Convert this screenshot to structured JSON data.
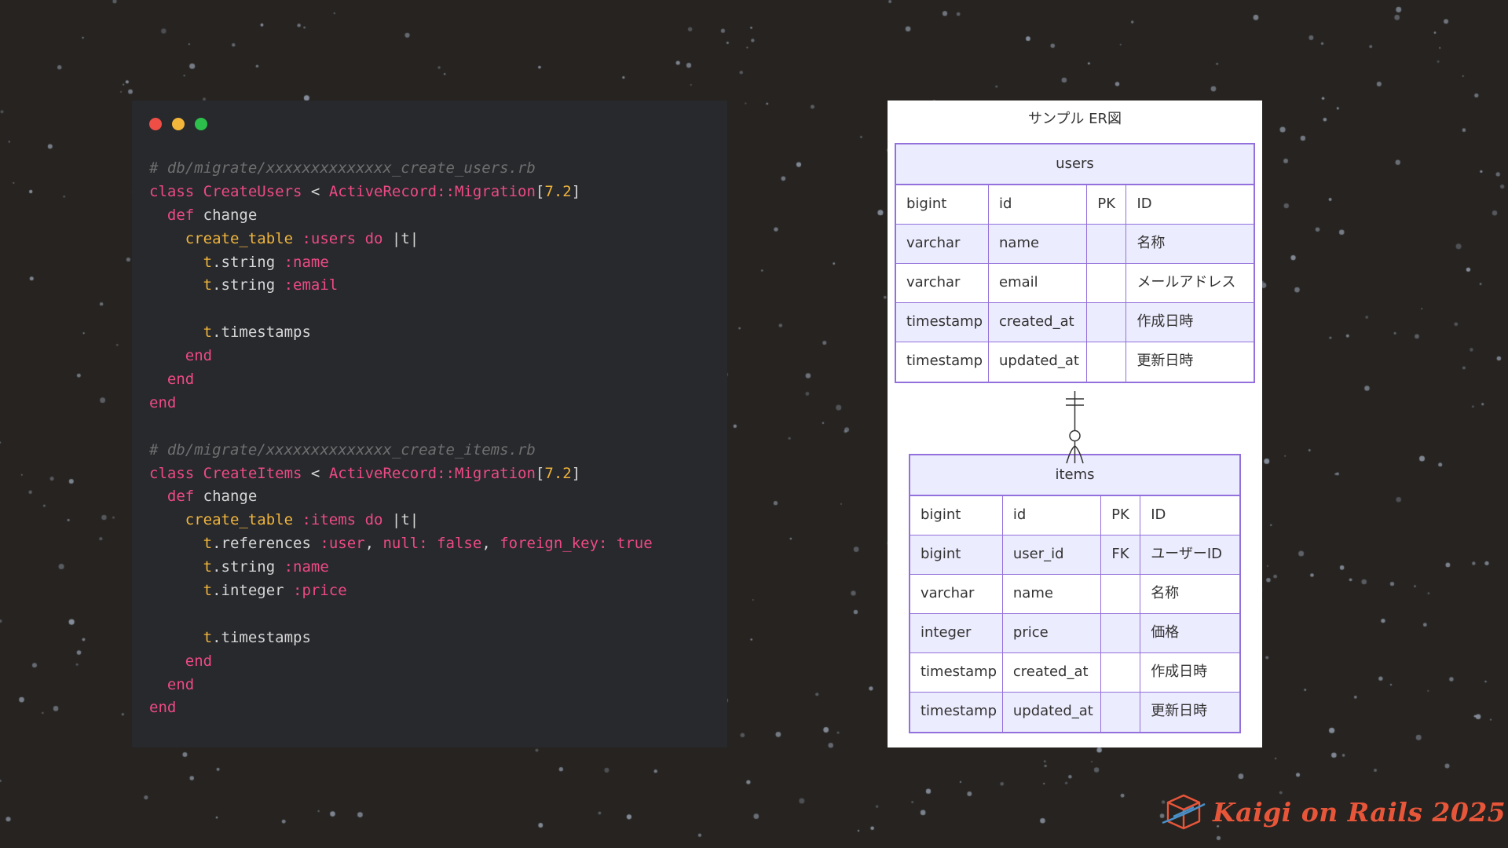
{
  "code": {
    "window_dot_colors": [
      "#ee4e45",
      "#f2b63a",
      "#2dbf4b"
    ],
    "lines": [
      [
        {
          "t": "comment",
          "v": "# db/migrate/xxxxxxxxxxxxxx_create_users.rb"
        }
      ],
      [
        {
          "t": "kw",
          "v": "class "
        },
        {
          "t": "const",
          "v": "CreateUsers"
        },
        {
          "t": "plain",
          "v": " < "
        },
        {
          "t": "const",
          "v": "ActiveRecord::Migration"
        },
        {
          "t": "plain",
          "v": "["
        },
        {
          "t": "num",
          "v": "7.2"
        },
        {
          "t": "plain",
          "v": "]"
        }
      ],
      [
        {
          "t": "plain",
          "v": "  "
        },
        {
          "t": "kw",
          "v": "def "
        },
        {
          "t": "plain",
          "v": "change"
        }
      ],
      [
        {
          "t": "plain",
          "v": "    "
        },
        {
          "t": "method",
          "v": "create_table "
        },
        {
          "t": "sym",
          "v": ":users"
        },
        {
          "t": "kw",
          "v": " do "
        },
        {
          "t": "plain",
          "v": "|t|"
        }
      ],
      [
        {
          "t": "plain",
          "v": "      "
        },
        {
          "t": "var",
          "v": "t"
        },
        {
          "t": "plain",
          "v": ".string "
        },
        {
          "t": "sym",
          "v": ":name"
        }
      ],
      [
        {
          "t": "plain",
          "v": "      "
        },
        {
          "t": "var",
          "v": "t"
        },
        {
          "t": "plain",
          "v": ".string "
        },
        {
          "t": "sym",
          "v": ":email"
        }
      ],
      [
        {
          "t": "plain",
          "v": ""
        }
      ],
      [
        {
          "t": "plain",
          "v": "      "
        },
        {
          "t": "var",
          "v": "t"
        },
        {
          "t": "plain",
          "v": ".timestamps"
        }
      ],
      [
        {
          "t": "plain",
          "v": "    "
        },
        {
          "t": "kw",
          "v": "end"
        }
      ],
      [
        {
          "t": "plain",
          "v": "  "
        },
        {
          "t": "kw",
          "v": "end"
        }
      ],
      [
        {
          "t": "kw",
          "v": "end"
        }
      ],
      [
        {
          "t": "plain",
          "v": ""
        }
      ],
      [
        {
          "t": "comment",
          "v": "# db/migrate/xxxxxxxxxxxxxx_create_items.rb"
        }
      ],
      [
        {
          "t": "kw",
          "v": "class "
        },
        {
          "t": "const",
          "v": "CreateItems"
        },
        {
          "t": "plain",
          "v": " < "
        },
        {
          "t": "const",
          "v": "ActiveRecord::Migration"
        },
        {
          "t": "plain",
          "v": "["
        },
        {
          "t": "num",
          "v": "7.2"
        },
        {
          "t": "plain",
          "v": "]"
        }
      ],
      [
        {
          "t": "plain",
          "v": "  "
        },
        {
          "t": "kw",
          "v": "def "
        },
        {
          "t": "plain",
          "v": "change"
        }
      ],
      [
        {
          "t": "plain",
          "v": "    "
        },
        {
          "t": "method",
          "v": "create_table "
        },
        {
          "t": "sym",
          "v": ":items"
        },
        {
          "t": "kw",
          "v": " do "
        },
        {
          "t": "plain",
          "v": "|t|"
        }
      ],
      [
        {
          "t": "plain",
          "v": "      "
        },
        {
          "t": "var",
          "v": "t"
        },
        {
          "t": "plain",
          "v": ".references "
        },
        {
          "t": "sym",
          "v": ":user"
        },
        {
          "t": "plain",
          "v": ", "
        },
        {
          "t": "sym",
          "v": "null:"
        },
        {
          "t": "kw",
          "v": " false"
        },
        {
          "t": "plain",
          "v": ", "
        },
        {
          "t": "sym",
          "v": "foreign_key:"
        },
        {
          "t": "kw",
          "v": " true"
        }
      ],
      [
        {
          "t": "plain",
          "v": "      "
        },
        {
          "t": "var",
          "v": "t"
        },
        {
          "t": "plain",
          "v": ".string "
        },
        {
          "t": "sym",
          "v": ":name"
        }
      ],
      [
        {
          "t": "plain",
          "v": "      "
        },
        {
          "t": "var",
          "v": "t"
        },
        {
          "t": "plain",
          "v": ".integer "
        },
        {
          "t": "sym",
          "v": ":price"
        }
      ],
      [
        {
          "t": "plain",
          "v": ""
        }
      ],
      [
        {
          "t": "plain",
          "v": "      "
        },
        {
          "t": "var",
          "v": "t"
        },
        {
          "t": "plain",
          "v": ".timestamps"
        }
      ],
      [
        {
          "t": "plain",
          "v": "    "
        },
        {
          "t": "kw",
          "v": "end"
        }
      ],
      [
        {
          "t": "plain",
          "v": "  "
        },
        {
          "t": "kw",
          "v": "end"
        }
      ],
      [
        {
          "t": "kw",
          "v": "end"
        }
      ]
    ]
  },
  "er": {
    "title": "サンプル ER図",
    "entities": [
      {
        "name": "users",
        "rows": [
          [
            "bigint",
            "id",
            "PK",
            "ID"
          ],
          [
            "varchar",
            "name",
            "",
            "名称"
          ],
          [
            "varchar",
            "email",
            "",
            "メールアドレス"
          ],
          [
            "timestamp",
            "created_at",
            "",
            "作成日時"
          ],
          [
            "timestamp",
            "updated_at",
            "",
            "更新日時"
          ]
        ]
      },
      {
        "name": "items",
        "rows": [
          [
            "bigint",
            "id",
            "PK",
            "ID"
          ],
          [
            "bigint",
            "user_id",
            "FK",
            "ユーザーID"
          ],
          [
            "varchar",
            "name",
            "",
            "名称"
          ],
          [
            "integer",
            "price",
            "",
            "価格"
          ],
          [
            "timestamp",
            "created_at",
            "",
            "作成日時"
          ],
          [
            "timestamp",
            "updated_at",
            "",
            "更新日時"
          ]
        ]
      }
    ],
    "relationship": {
      "from": "users",
      "to": "items",
      "from_cardinality": "exactly-one",
      "to_cardinality": "zero-or-many"
    }
  },
  "logo": {
    "text": "Kaigi on Rails 2025",
    "color": "#e8563a",
    "icon": "hexagon-gem-icon"
  }
}
